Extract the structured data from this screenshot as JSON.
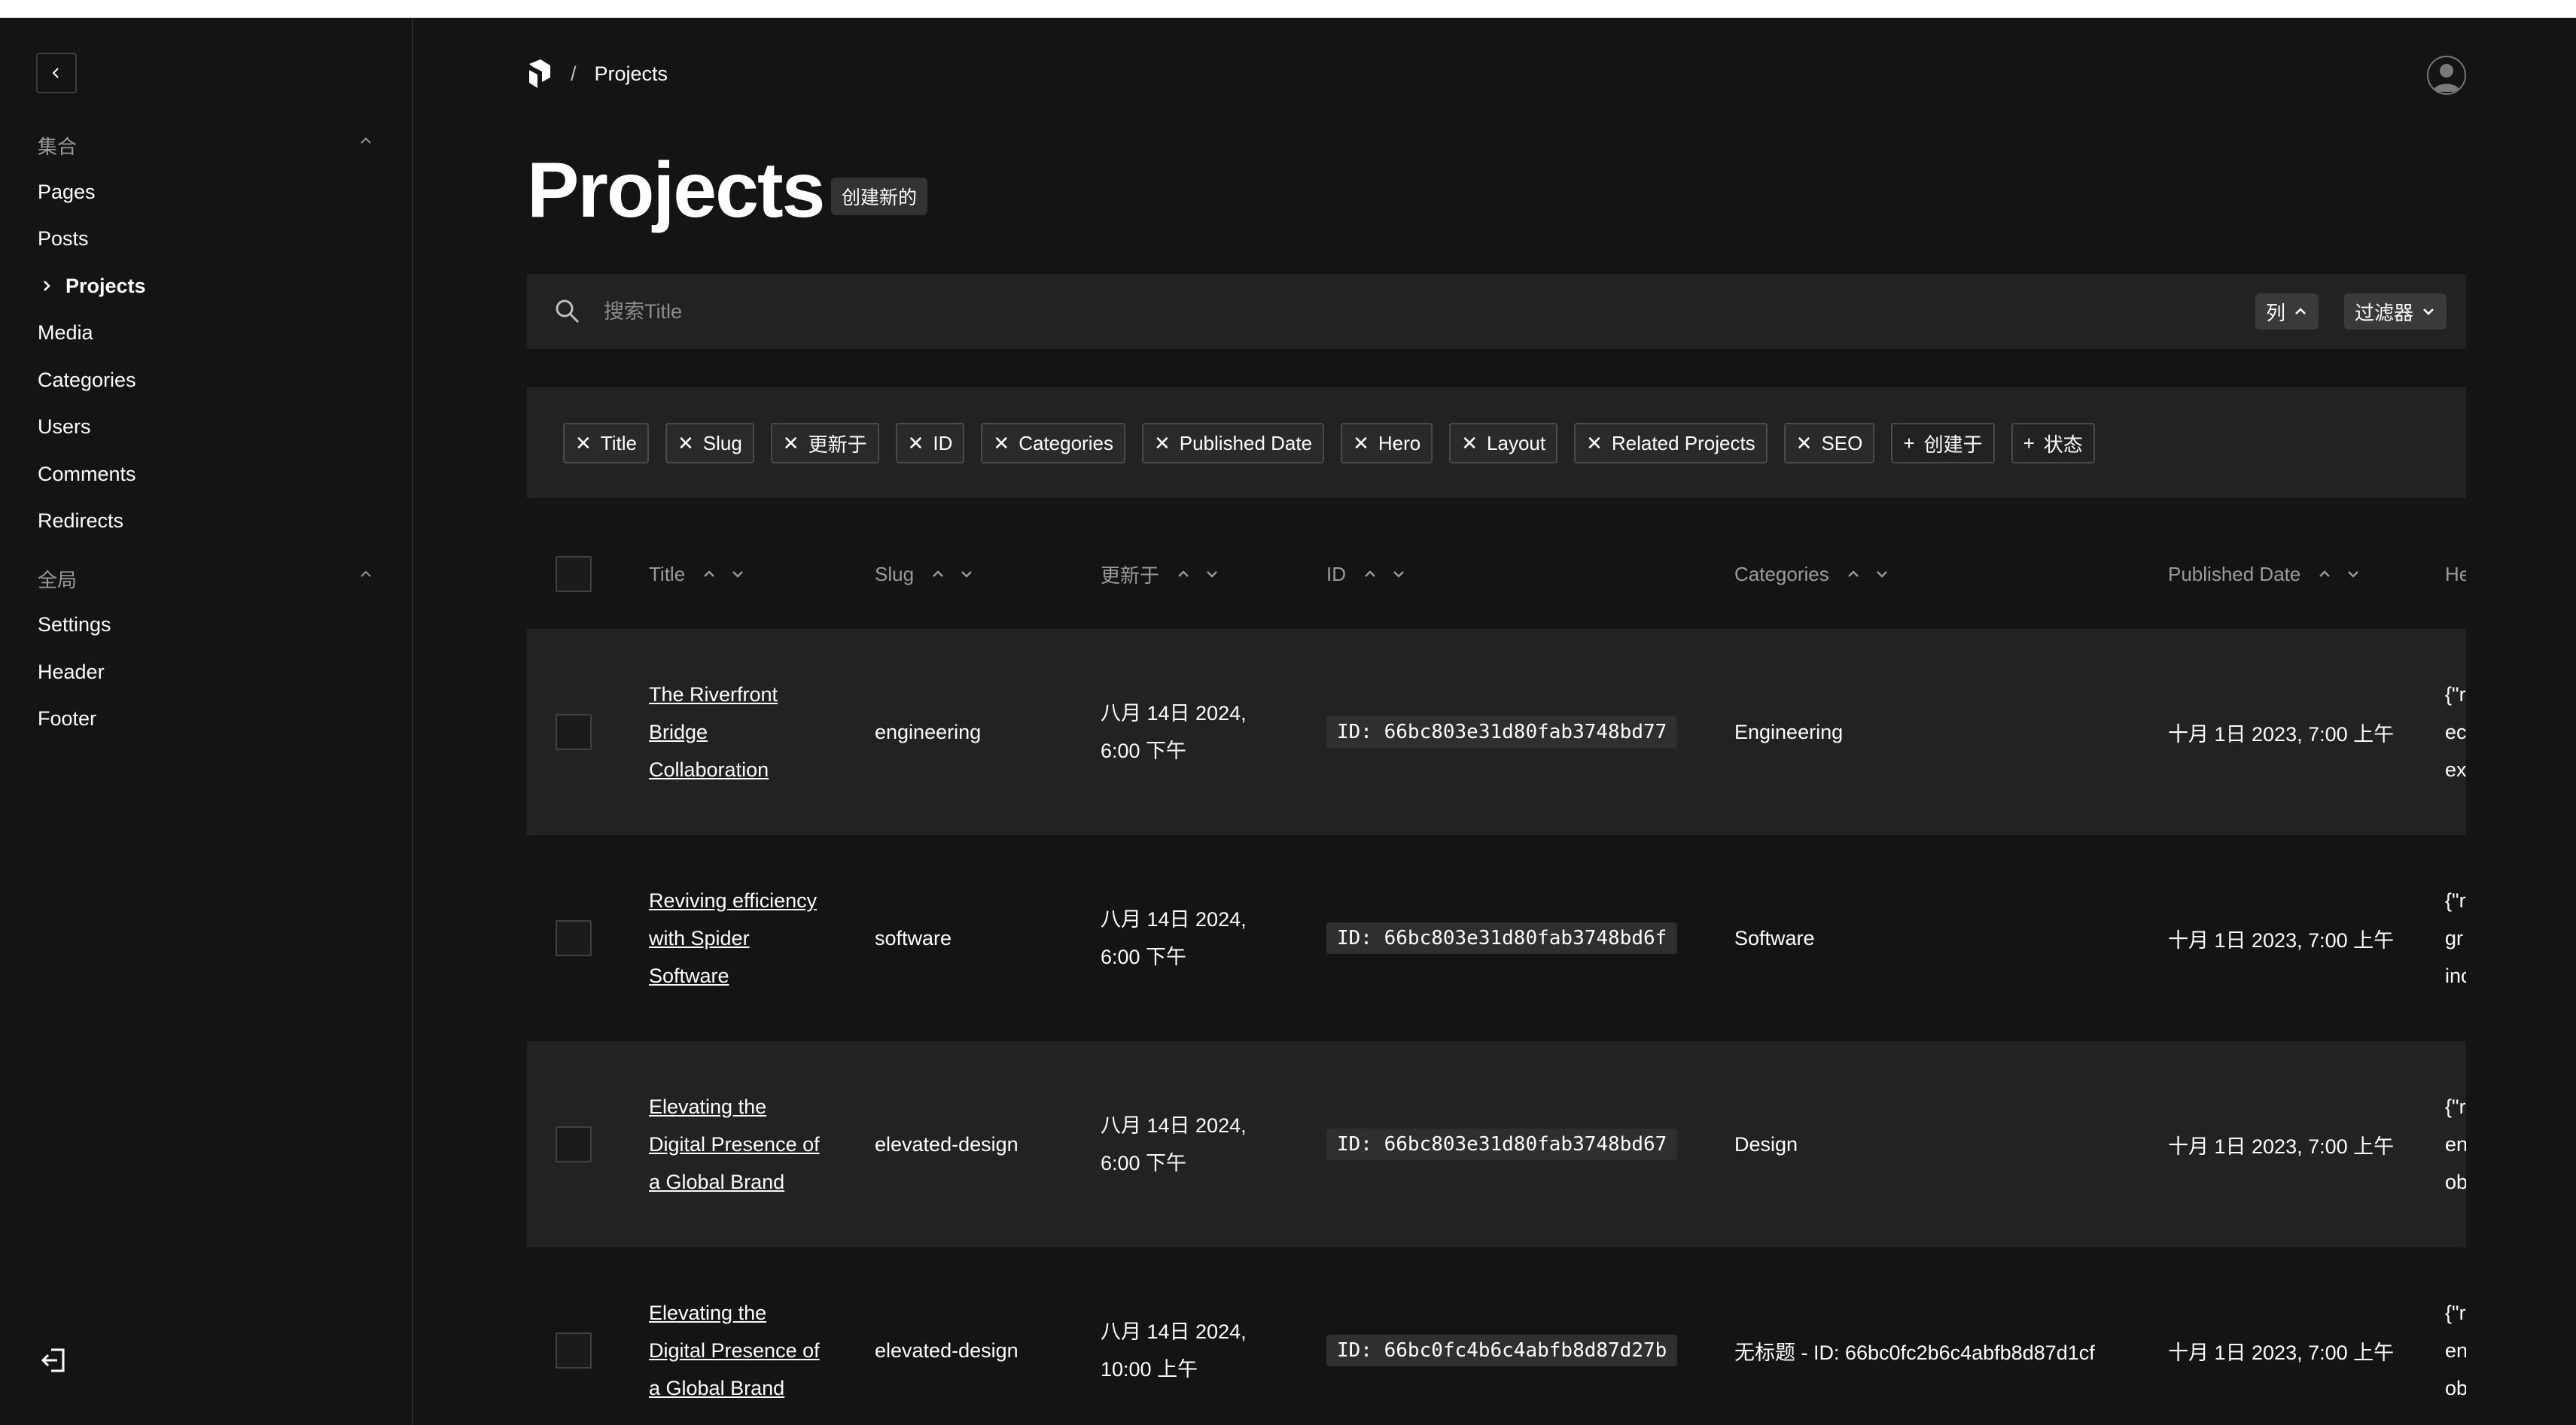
{
  "sidebar": {
    "groups": [
      {
        "label": "集合",
        "items": [
          "Pages",
          "Posts",
          "Projects",
          "Media",
          "Categories",
          "Users",
          "Comments",
          "Redirects"
        ]
      },
      {
        "label": "全局",
        "items": [
          "Settings",
          "Header",
          "Footer"
        ]
      }
    ],
    "active_item": "Projects"
  },
  "breadcrumb": {
    "separator": "/",
    "current": "Projects"
  },
  "page": {
    "title": "Projects",
    "create_new_label": "创建新的"
  },
  "search": {
    "placeholder": "搜索Title",
    "columns_label": "列",
    "filters_label": "过滤器"
  },
  "column_chips": [
    {
      "label": "Title",
      "active": true
    },
    {
      "label": "Slug",
      "active": true
    },
    {
      "label": "更新于",
      "active": true
    },
    {
      "label": "ID",
      "active": true
    },
    {
      "label": "Categories",
      "active": true
    },
    {
      "label": "Published Date",
      "active": true
    },
    {
      "label": "Hero",
      "active": true
    },
    {
      "label": "Layout",
      "active": true
    },
    {
      "label": "Related Projects",
      "active": true
    },
    {
      "label": "SEO",
      "active": true
    },
    {
      "label": "创建于",
      "active": false
    },
    {
      "label": "状态",
      "active": false
    }
  ],
  "table": {
    "headers": [
      "Title",
      "Slug",
      "更新于",
      "ID",
      "Categories",
      "Published Date",
      "He"
    ],
    "rows": [
      {
        "title_lines": [
          "The Riverfront",
          "Bridge",
          "Collaboration"
        ],
        "slug": "engineering",
        "updated_lines": [
          "八月 14日 2024,",
          "6:00 下午"
        ],
        "id": "ID: 66bc803e31d80fab3748bd77",
        "category": "Engineering",
        "published": "十月 1日 2023, 7:00 上午",
        "hero_lines": [
          "{\"ri",
          "ec",
          "ex"
        ]
      },
      {
        "title_lines": [
          "Reviving efficiency",
          "with Spider",
          "Software"
        ],
        "slug": "software",
        "updated_lines": [
          "八月 14日 2024,",
          "6:00 下午"
        ],
        "id": "ID: 66bc803e31d80fab3748bd6f",
        "category": "Software",
        "published": "十月 1日 2023, 7:00 上午",
        "hero_lines": [
          "{\"ri",
          "gr",
          "inc"
        ]
      },
      {
        "title_lines": [
          "Elevating the",
          "Digital Presence of",
          "a Global Brand"
        ],
        "slug": "elevated-design",
        "updated_lines": [
          "八月 14日 2024,",
          "6:00 下午"
        ],
        "id": "ID: 66bc803e31d80fab3748bd67",
        "category": "Design",
        "published": "十月 1日 2023, 7:00 上午",
        "hero_lines": [
          "{\"ri",
          "en",
          "ob"
        ]
      },
      {
        "title_lines": [
          "Elevating the",
          "Digital Presence of",
          "a Global Brand"
        ],
        "slug": "elevated-design",
        "updated_lines": [
          "八月 14日 2024,",
          "10:00 上午"
        ],
        "id": "ID: 66bc0fc4b6c4abfb8d87d27b",
        "category": "无标题 - ID: 66bc0fc2b6c4abfb8d87d1cf",
        "published": "十月 1日 2023, 7:00 上午",
        "hero_lines": [
          "{\"ri",
          "en",
          "ob"
        ]
      }
    ]
  },
  "icons": {
    "back": "chevron-left-icon",
    "group_toggle": "chevron-up-icon",
    "active_marker": "chevron-right-icon",
    "logo": "payload-logo-icon",
    "avatar": "user-avatar-icon",
    "search": "search-icon",
    "logout": "logout-icon"
  }
}
